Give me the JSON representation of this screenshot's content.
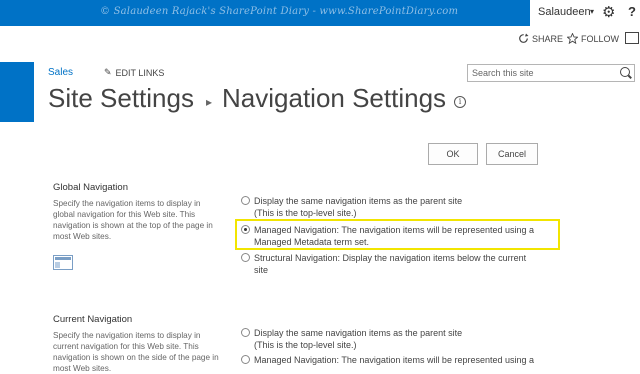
{
  "topbar": {
    "watermark": "© Salaudeen Rajack's SharePoint Diary - www.SharePointDiary.com",
    "user_name": "Salaudeen",
    "user_caret": "▾",
    "gear_icon": "⚙",
    "help_icon": "?"
  },
  "actions": {
    "share_label": "SHARE",
    "follow_label": "FOLLOW"
  },
  "breadcrumb": {
    "site": "Sales",
    "edit_links_icon": "✎",
    "edit_links": "EDIT LINKS"
  },
  "search": {
    "placeholder": "Search this site"
  },
  "page": {
    "title_part1": "Site Settings",
    "separator": "▸",
    "title_part2": "Navigation Settings",
    "info_icon": "i"
  },
  "buttons": {
    "ok": "OK",
    "cancel": "Cancel"
  },
  "global_nav": {
    "title": "Global Navigation",
    "description": "Specify the navigation items to display in global navigation for this Web site. This navigation is shown at the top of the page in most Web sites.",
    "options": [
      {
        "line1": "Display the same navigation items as the parent site",
        "line2": "(This is the top-level site.)",
        "checked": false
      },
      {
        "line1": "Managed Navigation: The navigation items will be represented using a",
        "line2": "Managed Metadata term set.",
        "checked": true
      },
      {
        "line1": "Structural Navigation: Display the navigation items below the current",
        "line2": "site",
        "checked": false
      }
    ]
  },
  "current_nav": {
    "title": "Current Navigation",
    "description": "Specify the navigation items to display in current navigation for this Web site. This navigation is shown on the side of the page in most Web sites.",
    "options": [
      {
        "line1": "Display the same navigation items as the parent site",
        "line2": "(This is the top-level site.)",
        "checked": false
      },
      {
        "line1": "Managed Navigation: The navigation items will be represented using a",
        "line2": "",
        "checked": false
      }
    ]
  },
  "colors": {
    "suite_bar": "#0072c6",
    "highlight": "#f2e500"
  }
}
